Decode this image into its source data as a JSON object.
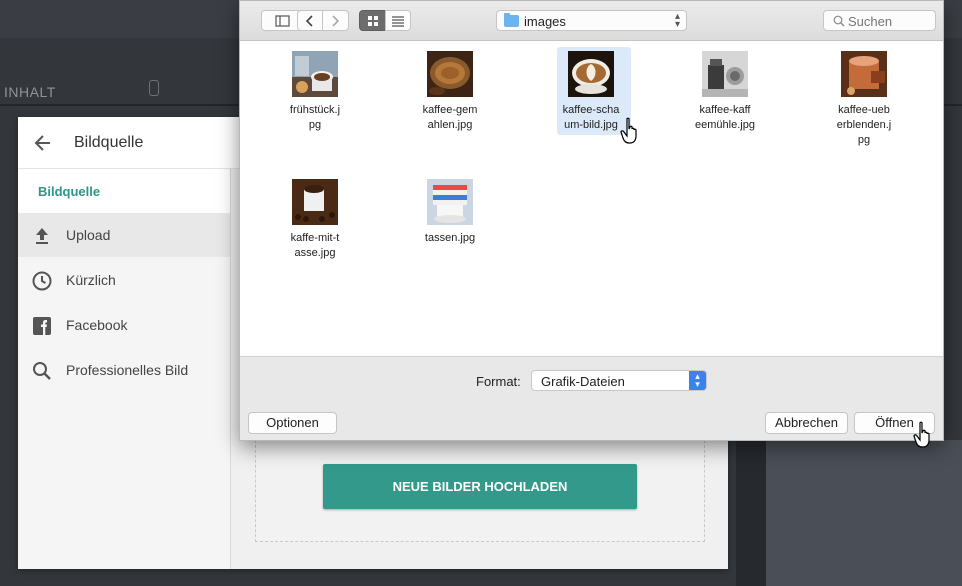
{
  "background": {
    "section_label": "INHALT"
  },
  "modal": {
    "title": "Bildquelle",
    "sidebar": {
      "section_heading": "Bildquelle",
      "items": [
        {
          "label": "Upload",
          "icon": "upload-icon",
          "selected": true
        },
        {
          "label": "Kürzlich",
          "icon": "clock-icon",
          "selected": false
        },
        {
          "label": "Facebook",
          "icon": "facebook-icon",
          "selected": false
        },
        {
          "label": "Professionelles Bild",
          "icon": "search-icon",
          "selected": false
        }
      ]
    },
    "upload_button": "NEUE BILDER HOCHLADEN",
    "accent_color": "#33998a"
  },
  "dialog": {
    "folder": "images",
    "search_placeholder": "Suchen",
    "files": [
      {
        "name": "frühstück.j\npg",
        "icon": "coffee-breakfast-thumbnail"
      },
      {
        "name": "kaffee-gem\nahlen.jpg",
        "icon": "ground-coffee-thumbnail"
      },
      {
        "name": "kaffee-scha\num-bild.jpg",
        "icon": "latte-art-thumbnail",
        "selected": true
      },
      {
        "name": "kaffee-kaff\neemühle.jpg",
        "icon": "coffee-grinder-thumbnail"
      },
      {
        "name": "kaffee-ueb\nerblenden.j\npg",
        "icon": "coffee-cup-thumbnail"
      },
      {
        "name": "kaffe-mit-t\nasse.jpg",
        "icon": "coffee-beans-cup-thumbnail"
      },
      {
        "name": "tassen.jpg",
        "icon": "stacked-cups-thumbnail"
      }
    ],
    "format_label": "Format:",
    "format_value": "Grafik-Dateien",
    "buttons": {
      "options": "Optionen",
      "cancel": "Abbrechen",
      "open": "Öffnen"
    }
  }
}
